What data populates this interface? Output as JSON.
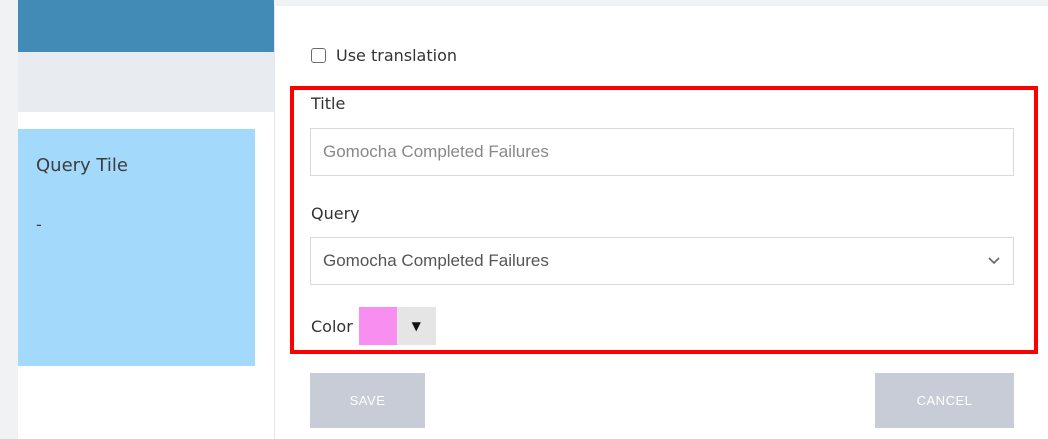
{
  "left": {
    "tile": {
      "title": "Query Tile",
      "value": "-",
      "color": "#a3d9fa"
    },
    "header_color": "#428bb7"
  },
  "form": {
    "use_translation": {
      "label": "Use translation",
      "checked": false
    },
    "title": {
      "label": "Title",
      "value": "Gomocha Completed Failures"
    },
    "query": {
      "label": "Query",
      "selected": "Gomocha Completed Failures"
    },
    "color": {
      "label": "Color",
      "value": "#f78ef0",
      "dropdown_glyph": "▼"
    },
    "buttons": {
      "save": "SAVE",
      "cancel": "CANCEL"
    },
    "highlight_color": "#ff0000"
  },
  "icons": {
    "select_arrow": "chevron-down-icon"
  }
}
